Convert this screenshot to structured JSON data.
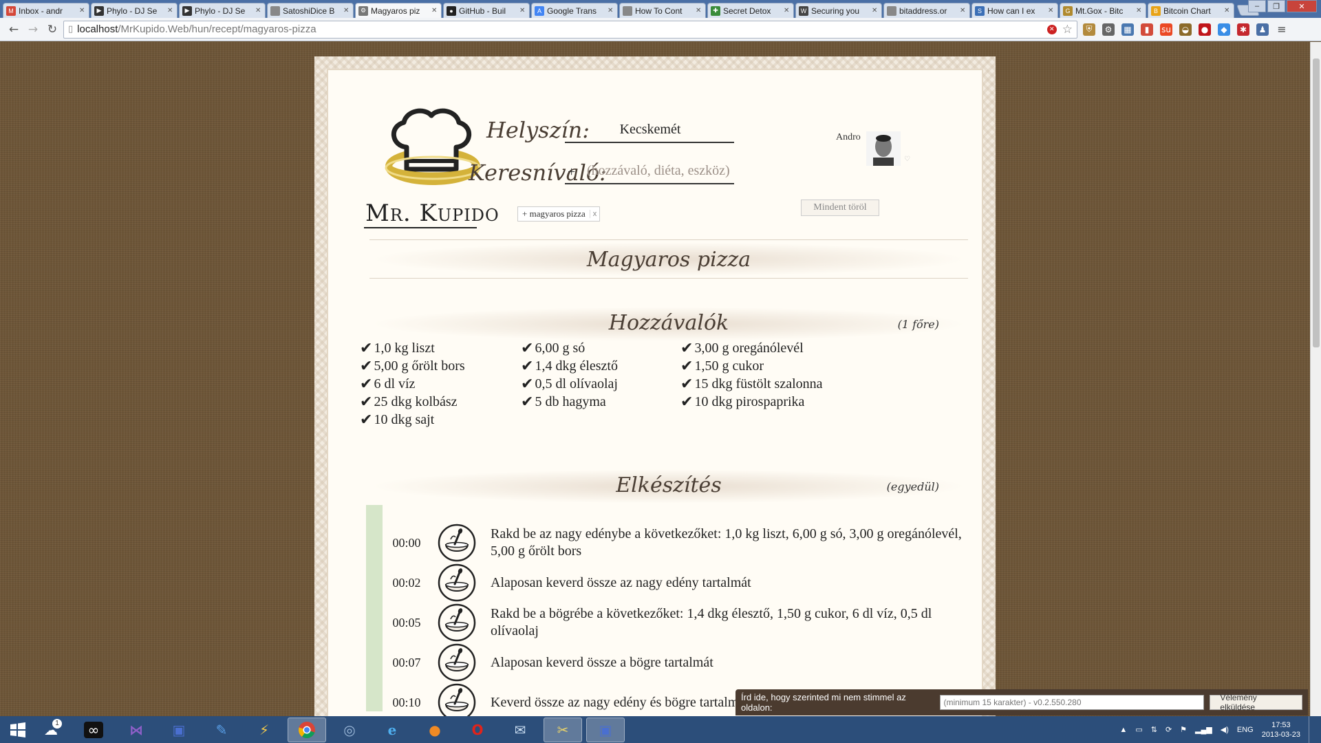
{
  "browser": {
    "tabs": [
      {
        "title": "Inbox - andr",
        "icon": "gmail-icon",
        "color": "#d44638",
        "glyph": "M"
      },
      {
        "title": "Phylo - DJ Se",
        "icon": "play-icon",
        "color": "#333333",
        "glyph": "▶"
      },
      {
        "title": "Phylo - DJ Se",
        "icon": "play-icon",
        "color": "#333333",
        "glyph": "▶"
      },
      {
        "title": "SatoshiDice B",
        "icon": "page-icon",
        "color": "#888888",
        "glyph": ""
      },
      {
        "title": "Magyaros piz",
        "icon": "gear-icon",
        "color": "#777777",
        "glyph": "⚙",
        "active": true
      },
      {
        "title": "GitHub - Buil",
        "icon": "github-icon",
        "color": "#222222",
        "glyph": "●"
      },
      {
        "title": "Google Trans",
        "icon": "translate-icon",
        "color": "#4285f4",
        "glyph": "A"
      },
      {
        "title": "How To Cont",
        "icon": "page-icon",
        "color": "#888888",
        "glyph": ""
      },
      {
        "title": "Secret Detox",
        "icon": "leaf-icon",
        "color": "#3a8c3a",
        "glyph": "✚"
      },
      {
        "title": "Securing you",
        "icon": "wikipedia-icon",
        "color": "#444444",
        "glyph": "W"
      },
      {
        "title": "bitaddress.or",
        "icon": "page-icon",
        "color": "#888888",
        "glyph": ""
      },
      {
        "title": "How can I ex",
        "icon": "stackexchange-icon",
        "color": "#3b6fb6",
        "glyph": "S"
      },
      {
        "title": "Mt.Gox - Bitc",
        "icon": "mtgox-icon",
        "color": "#b08a2e",
        "glyph": "G"
      },
      {
        "title": "Bitcoin Chart",
        "icon": "bitcoin-icon",
        "color": "#e8a317",
        "glyph": "B"
      }
    ],
    "url_host": "localhost",
    "url_path": "/MrKupido.Web/hun/recept/magyaros-pizza"
  },
  "site": {
    "logo_text_big": "Mr. Kupido",
    "location_label": "Helyszín:",
    "location_value": "Kecskemét",
    "search_label": "Keresnívaló:",
    "search_plus": "+",
    "search_placeholder": "(hozzávaló, diéta, eszköz)",
    "active_tag": "+ magyaros pizza",
    "tag_remove": "x",
    "user_name": "Andro",
    "clear_all": "Mindent töröl"
  },
  "recipe": {
    "title": "Magyaros pizza",
    "ingredients_title": "Hozzávalók",
    "servings": "(1 főre)",
    "ingredients": [
      "1,0 kg liszt",
      "6,00 g só",
      "3,00 g oregánólevél",
      "5,00 g őrölt bors",
      "1,4 dkg élesztő",
      "1,50 g cukor",
      "6 dl víz",
      "0,5 dl olívaolaj",
      "15 dkg füstölt szalonna",
      "25 dkg kolbász",
      "5 db hagyma",
      "10 dkg pirospaprika",
      "10 dkg sajt"
    ],
    "steps_title": "Elkészítés",
    "steps_note": "(egyedül)",
    "steps": [
      {
        "time": "00:00",
        "text": "Rakd be az nagy edénybe a következőket: 1,0 kg liszt, 6,00 g só, 3,00 g oregánólevél, 5,00 g őrölt bors"
      },
      {
        "time": "00:02",
        "text": "Alaposan keverd össze az nagy edény tartalmát"
      },
      {
        "time": "00:05",
        "text": "Rakd be a bögrébe a következőket: 1,4 dkg élesztő, 1,50 g cukor, 6 dl víz, 0,5 dl olívaolaj"
      },
      {
        "time": "00:07",
        "text": "Alaposan keverd össze a bögre tartalmát"
      },
      {
        "time": "00:10",
        "text": "Keverd össze az nagy edény és bögre tartalmát"
      }
    ]
  },
  "feedback": {
    "label": "Írd ide, hogy szerinted mi nem stimmel az oldalon:",
    "placeholder": "(minimum 15 karakter) - v0.2.550.280",
    "button": "Vélemény elküldése"
  },
  "taskbar": {
    "badge": "1",
    "lang": "ENG",
    "time": "17:53",
    "date": "2013-03-23"
  }
}
